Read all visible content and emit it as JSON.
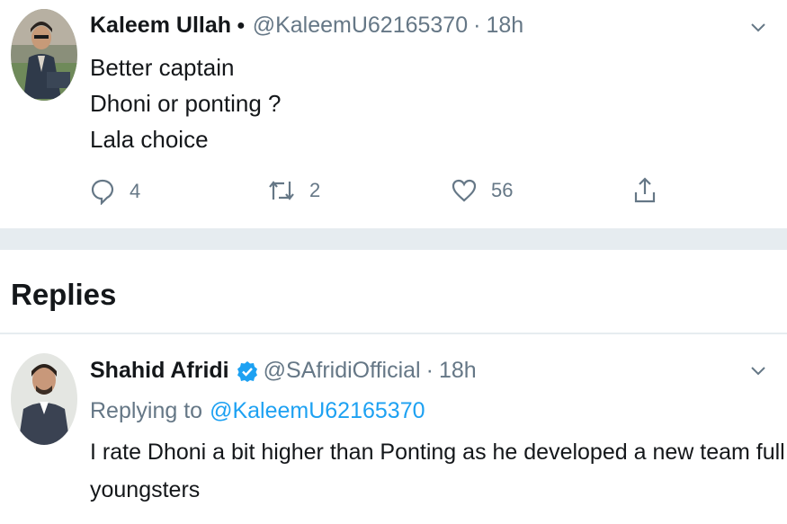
{
  "main_tweet": {
    "author_name": "Kaleem Ullah",
    "separator": "●",
    "handle": "@KaleemU62165370",
    "time_separator": "·",
    "time": "18h",
    "lines": [
      "Better captain",
      "Dhoni  or ponting ?",
      "Lala choice"
    ],
    "actions": {
      "reply_count": "4",
      "retweet_count": "2",
      "like_count": "56"
    }
  },
  "replies_section": {
    "title": "Replies"
  },
  "reply_tweet": {
    "author_name": "Shahid Afridi",
    "handle": "@SAfridiOfficial",
    "time_separator": "·",
    "time": "18h",
    "replying_prefix": "Replying to",
    "replying_handle": "@KaleemU62165370",
    "lines": [
      "I rate Dhoni a bit higher than Ponting as he developed a new team full of",
      "youngsters"
    ]
  },
  "icons": {
    "caret": "chevron-down-icon",
    "reply": "reply-icon",
    "retweet": "retweet-icon",
    "like": "heart-icon",
    "share": "share-icon",
    "verified": "verified-badge-icon"
  },
  "colors": {
    "text_primary": "#14171a",
    "text_secondary": "#657786",
    "link": "#1da1f2",
    "divider": "#e6ecf0"
  }
}
